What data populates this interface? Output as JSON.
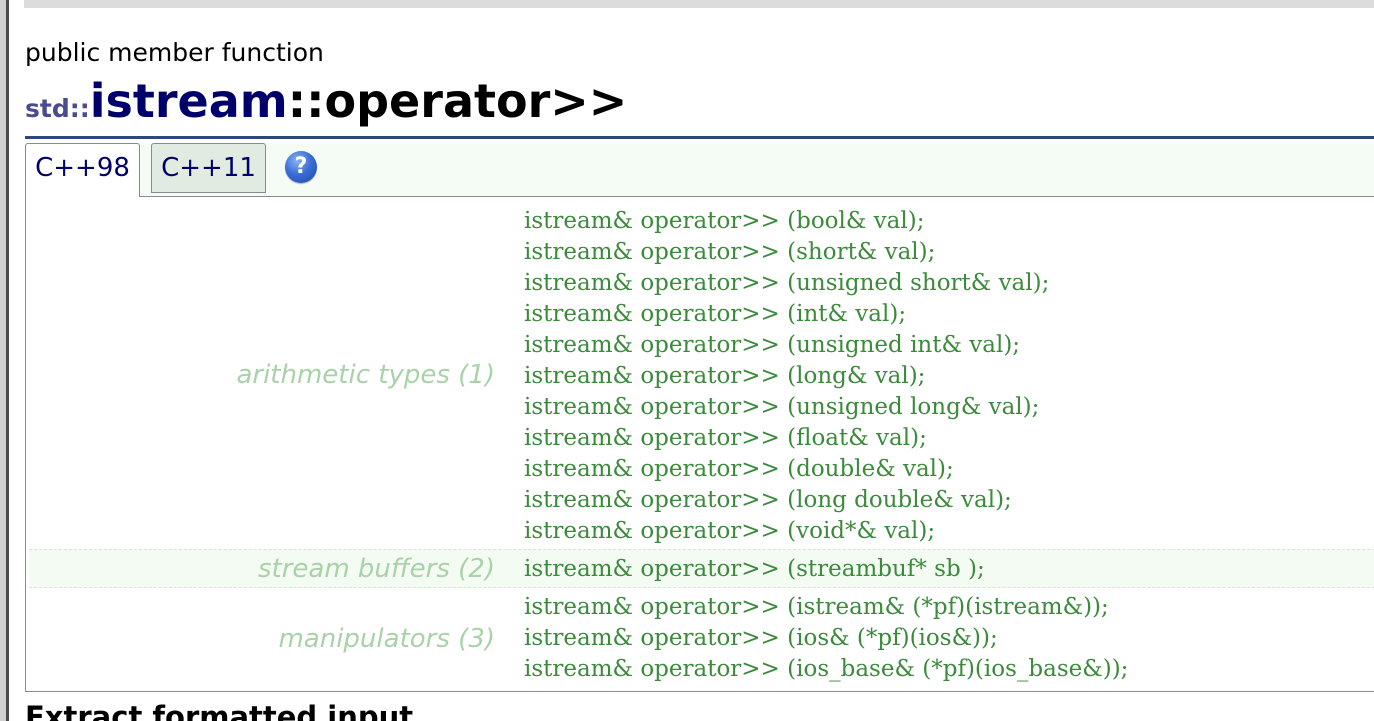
{
  "page": {
    "kind": "public member function",
    "title_ns": "std::",
    "title_class": "istream",
    "title_op": "::operator>>"
  },
  "tabs": [
    {
      "label": "C++98",
      "active": true
    },
    {
      "label": "C++11",
      "active": false
    }
  ],
  "help_icon": "?",
  "groups": [
    {
      "label": "arithmetic types (1)",
      "lines": [
        "istream& operator>> (bool& val);",
        "istream& operator>> (short& val);",
        "istream& operator>> (unsigned short& val);",
        "istream& operator>> (int& val);",
        "istream& operator>> (unsigned int& val);",
        "istream& operator>> (long& val);",
        "istream& operator>> (unsigned long& val);",
        "istream& operator>> (float& val);",
        "istream& operator>> (double& val);",
        "istream& operator>> (long double& val);",
        "istream& operator>> (void*& val);"
      ]
    },
    {
      "label": "stream buffers (2)",
      "lines": [
        "istream& operator>> (streambuf* sb );"
      ]
    },
    {
      "label": "manipulators (3)",
      "lines": [
        "istream& operator>> (istream& (*pf)(istream&));",
        "istream& operator>> (ios& (*pf)(ios&));",
        "istream& operator>> (ios_base& (*pf)(ios_base&));"
      ]
    }
  ],
  "next_heading": "Extract formatted input",
  "colors": {
    "title_navy": "#00006b",
    "code_green": "#3c8a3c",
    "label_green": "#a9d2a9",
    "rule_blue": "#2b4a78"
  }
}
